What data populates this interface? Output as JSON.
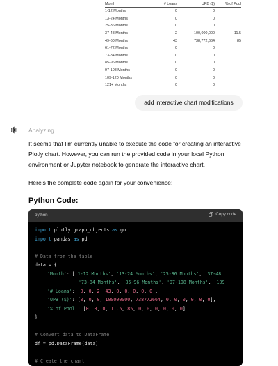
{
  "table": {
    "headers": [
      "Month",
      "# Loans",
      "UPB ($)",
      "% of Pool"
    ],
    "rows": [
      [
        "1-12 Months",
        "0",
        "0",
        ""
      ],
      [
        "13-24 Months",
        "0",
        "0",
        ""
      ],
      [
        "25-36 Months",
        "0",
        "0",
        ""
      ],
      [
        "37-48 Months",
        "2",
        "100,000,000",
        "11.5"
      ],
      [
        "49-60 Months",
        "43",
        "738,772,664",
        "85"
      ],
      [
        "61-72 Months",
        "0",
        "0",
        ""
      ],
      [
        "73-84 Months",
        "0",
        "0",
        ""
      ],
      [
        "85-96 Months",
        "0",
        "0",
        ""
      ],
      [
        "97-108 Months",
        "0",
        "0",
        ""
      ],
      [
        "109-120 Months",
        "0",
        "0",
        ""
      ],
      [
        "121+ Months",
        "0",
        "0",
        ""
      ]
    ]
  },
  "user_message": "add interactive chart modifications",
  "assistant": {
    "status": "Analyzing",
    "paragraph1": "It seems that I'm currently unable to execute the code for creating an interactive Plotly chart. However, you can run the provided code in your local Python environment or Jupyter notebook to generate the interactive chart.",
    "paragraph2": "Here's the complete code again for your convenience:",
    "heading": "Python Code:"
  },
  "code_block": {
    "language": "python",
    "copy_label": "Copy code",
    "l1_kw1": "import",
    "l1_mid": " plotly.graph_objects ",
    "l1_kw2": "as",
    "l1_end": " go",
    "l2_kw1": "import",
    "l2_mid": " pandas ",
    "l2_kw2": "as",
    "l2_end": " pd",
    "l4": "# Data from the table",
    "l5": "data = {",
    "l6_key": "'Month'",
    "l6_rest": ": [",
    "l6_s1": "'1-12 Months'",
    "l6_s2": "'13-24 Months'",
    "l6_s3": "'25-36 Months'",
    "l6_s4": "'37-48",
    "l7_s1": "'73-84 Months'",
    "l7_s2": "'85-96 Months'",
    "l7_s3": "'97-108 Months'",
    "l7_s4": "'109",
    "l8_key": "'# Loans'",
    "l8_rest": ": [",
    "l8_n1": "0",
    "l8_n2": "0",
    "l8_n3": "2",
    "l8_n4": "43",
    "l8_n5": "0",
    "l8_n6": "0",
    "l8_n7": "0",
    "l8_n8": "0",
    "l8_n9": "0",
    "l9_key": "'UPB ($)'",
    "l9_rest": ": [",
    "l9_n1": "0",
    "l9_n2": "0",
    "l9_n3": "0",
    "l9_n4": "100000000",
    "l9_n5": "738772664",
    "l9_n6": "0",
    "l9_n7": "0",
    "l9_n8": "0",
    "l9_n9": "0",
    "l9_n10": "0",
    "l9_n11": "0",
    "l10_key": "'% of Pool'",
    "l10_rest": ": [",
    "l10_n1": "0",
    "l10_n2": "0",
    "l10_n3": "0",
    "l10_n4": "11.5",
    "l10_n5": "85",
    "l10_n6": "0",
    "l10_n7": "0",
    "l10_n8": "0",
    "l10_n9": "0",
    "l10_n10": "0",
    "l10_n11": "0",
    "l11": "}",
    "l13": "# Convert data to DataFrame",
    "l14": "df = pd.DataFrame(data)",
    "l16": "# Create the chart"
  }
}
